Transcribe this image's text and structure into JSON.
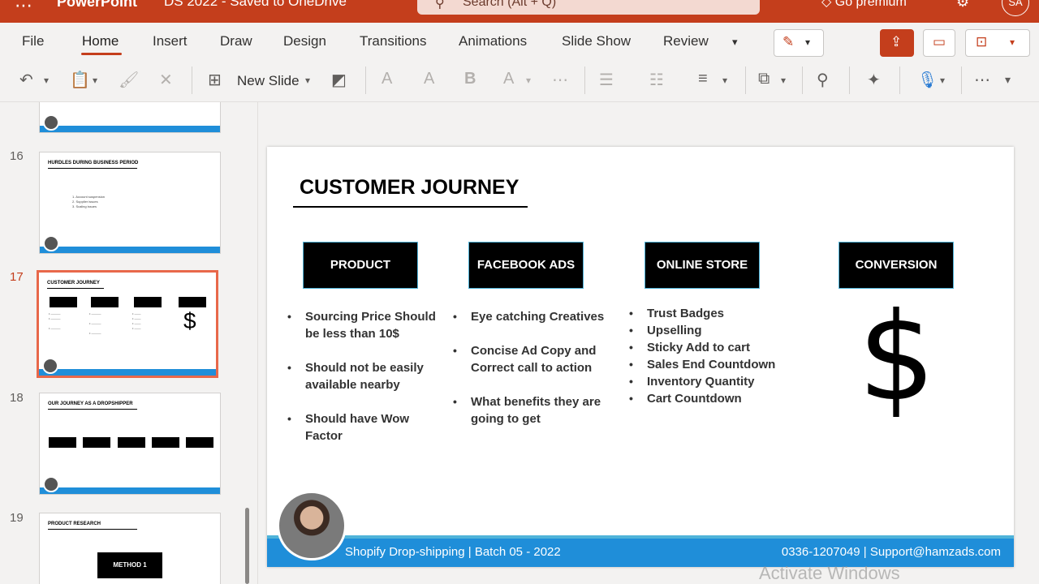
{
  "titlebar": {
    "app": "PowerPoint",
    "doc": "DS 2022 - Saved to OneDrive",
    "search_placeholder": "Search (Alt + Q)",
    "premium": "Go premium",
    "avatar": "SA"
  },
  "tabs": [
    "File",
    "Home",
    "Insert",
    "Draw",
    "Design",
    "Transitions",
    "Animations",
    "Slide Show",
    "Review"
  ],
  "commands": {
    "new_slide": "New Slide"
  },
  "thumbnails": [
    {
      "num": "16",
      "title": "HURDLES DURING BUSINESS PERIOD",
      "items": [
        "1.   Account suspension",
        "2.   Supplier issues",
        "3.   Scaling issues"
      ]
    },
    {
      "num": "17",
      "title": "CUSTOMER JOURNEY"
    },
    {
      "num": "18",
      "title": "OUR JOURNEY AS A DROPSHIPPER"
    },
    {
      "num": "19",
      "title": "PRODUCT RESEARCH",
      "box": "METHOD 1"
    }
  ],
  "slide": {
    "title": "CUSTOMER JOURNEY",
    "columns": [
      {
        "header": "PRODUCT",
        "items": [
          "Sourcing Price Should be less than 10$",
          "Should not be easily available nearby",
          "Should have Wow Factor"
        ]
      },
      {
        "header": "FACEBOOK ADS",
        "items": [
          "Eye catching Creatives",
          "Concise Ad Copy and Correct call to action",
          "What benefits they are going to get"
        ]
      },
      {
        "header": "ONLINE STORE",
        "items": [
          "Trust Badges",
          "Upselling",
          "Sticky Add to cart",
          "Sales End Countdown",
          "Inventory Quantity",
          "Cart Countdown"
        ]
      },
      {
        "header": "CONVERSION",
        "symbol": "$"
      }
    ],
    "footer_left": "Shopify Drop-shipping | Batch 05 - 2022",
    "footer_right": "0336-1207049  |   Support@hamzads.com"
  },
  "watermark": "Activate Windows"
}
